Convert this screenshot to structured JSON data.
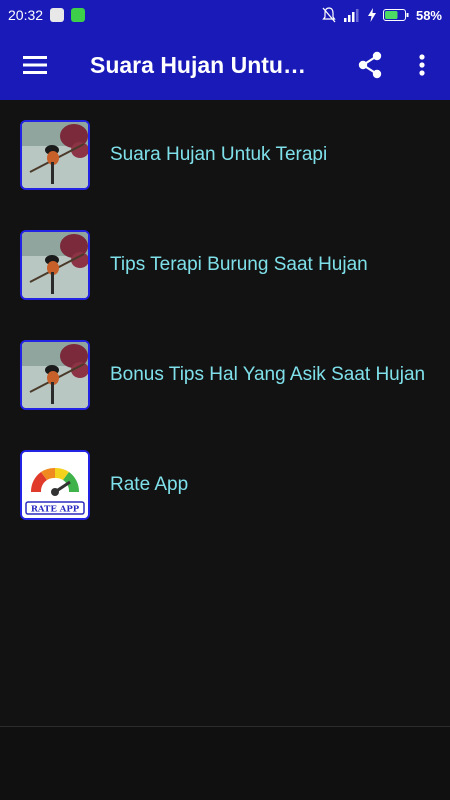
{
  "status_bar": {
    "time": "20:32",
    "battery_percent": "58%",
    "battery_level": 0.58
  },
  "app_bar": {
    "title": "Suara Hujan Untuk Terapi",
    "menu_icon": "hamburger-menu-icon",
    "share_icon": "share-icon",
    "more_icon": "more-vert-icon"
  },
  "menu": {
    "items": [
      {
        "label": "Suara Hujan Untuk Terapi",
        "icon": "bird-photo-icon"
      },
      {
        "label": "Tips Terapi Burung Saat Hujan",
        "icon": "bird-photo-icon"
      },
      {
        "label": "Bonus Tips Hal Yang Asik Saat Hujan",
        "icon": "bird-photo-icon"
      },
      {
        "label": "Rate App",
        "icon": "rate-app-gauge-icon",
        "icon_text": "RATE APP"
      }
    ]
  },
  "colors": {
    "primary": "#1a1ab8",
    "background": "#121212",
    "item_text": "#7fe0ea",
    "thumb_border": "#2323e6"
  }
}
